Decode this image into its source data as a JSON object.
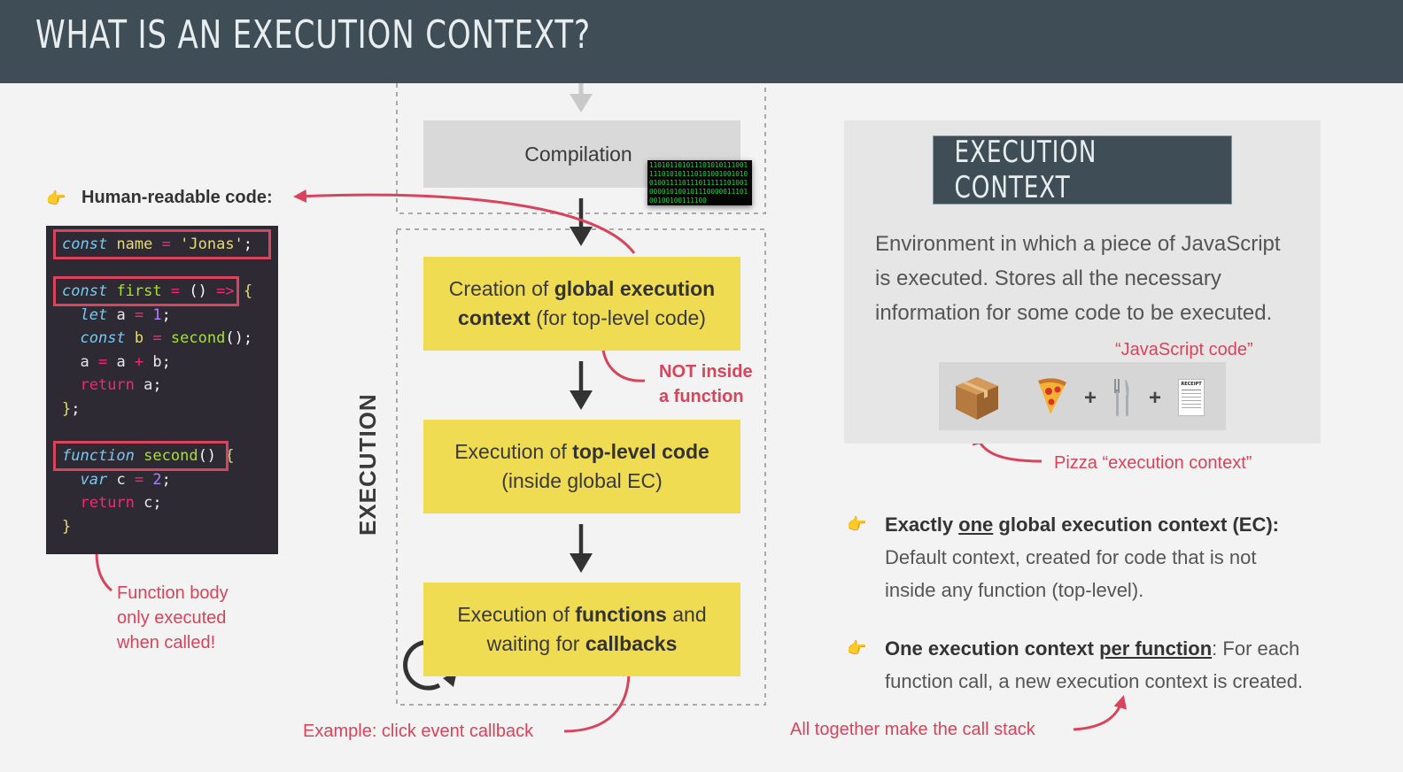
{
  "header": {
    "title": "WHAT IS AN EXECUTION CONTEXT?"
  },
  "left": {
    "human_label": "Human-readable code:",
    "code_lines": [
      "const name = 'Jonas';",
      "const first = () => {",
      "  let a = 1;",
      "  const b = second();",
      "  a = a + b;",
      "  return a;",
      "};",
      "function second() {",
      "  var c = 2;",
      "  return c;",
      "}"
    ],
    "function_note": [
      "Function body",
      "only executed",
      "when called!"
    ]
  },
  "flow": {
    "compilation": "Compilation",
    "binary_text": "11010110101110101011100111101010111010100100101001001111011101111110100100001010010111000001110100100100111100",
    "step1_pre": "Creation of ",
    "step1_bold": "global execution context",
    "step1_post": " (for top-level code)",
    "step2_pre": "Execution of ",
    "step2_bold": "top-level code",
    "step2_post": "(inside global EC)",
    "step3_pre": "Execution of ",
    "step3_bold1": "functions",
    "step3_mid": " and waiting for ",
    "step3_bold2": "callbacks",
    "execution_label": "EXECUTION",
    "not_inside": [
      "NOT inside",
      "a function"
    ],
    "callback_example": "Example: click event callback"
  },
  "context": {
    "box_title": "EXECUTION CONTEXT",
    "definition": [
      "Environment in which a piece of JavaScript",
      "is executed. Stores all the necessary",
      "information for some code to be executed."
    ],
    "js_code_label": "“JavaScript code”",
    "pizza_label": "Pizza “execution context”",
    "plus": "+",
    "receipt_text": "RECEIPT"
  },
  "bullets": {
    "b1_pre": "Exactly ",
    "b1_u": "one",
    "b1_post": " global execution context (EC):",
    "b1_desc1": "Default context, created for code that is not",
    "b1_desc2": "inside any function (top-level).",
    "b2_pre": "One execution context ",
    "b2_u": "per function",
    "b2_post": ": For each",
    "b2_desc": "function call, a new execution context is created.",
    "call_stack": "All together make the call stack"
  },
  "colors": {
    "accent_red": "#d9435c",
    "header_bg": "#3f4e56",
    "yellow": "#f0dc52",
    "hand": "#e8a400"
  }
}
